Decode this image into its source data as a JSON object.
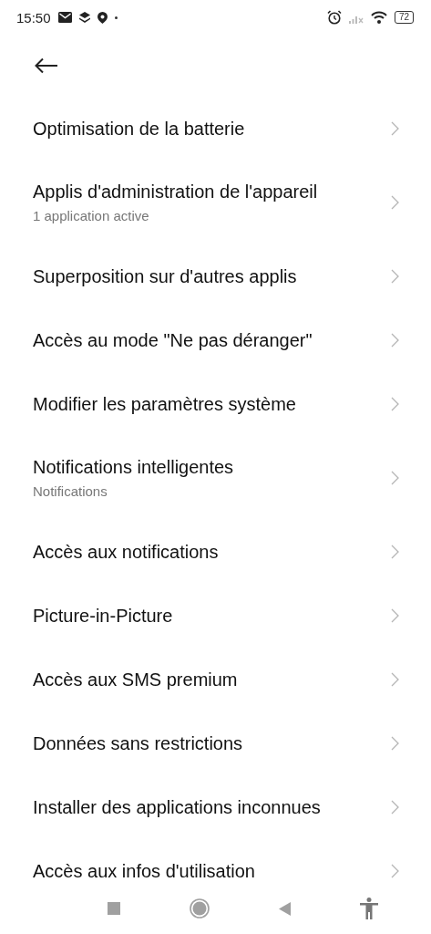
{
  "status_bar": {
    "time": "15:50",
    "battery": "72"
  },
  "items": [
    {
      "title": "Optimisation de la batterie"
    },
    {
      "title": "Applis d'administration de l'appareil",
      "subtitle": "1 application active"
    },
    {
      "title": "Superposition sur d'autres applis"
    },
    {
      "title": "Accès au mode \"Ne pas déranger\""
    },
    {
      "title": "Modifier les paramètres système"
    },
    {
      "title": "Notifications intelligentes",
      "subtitle": "Notifications"
    },
    {
      "title": "Accès aux notifications"
    },
    {
      "title": "Picture-in-Picture"
    },
    {
      "title": "Accès aux SMS premium"
    },
    {
      "title": "Données sans restrictions"
    },
    {
      "title": "Installer des applications inconnues"
    },
    {
      "title": "Accès aux infos d'utilisation"
    }
  ]
}
